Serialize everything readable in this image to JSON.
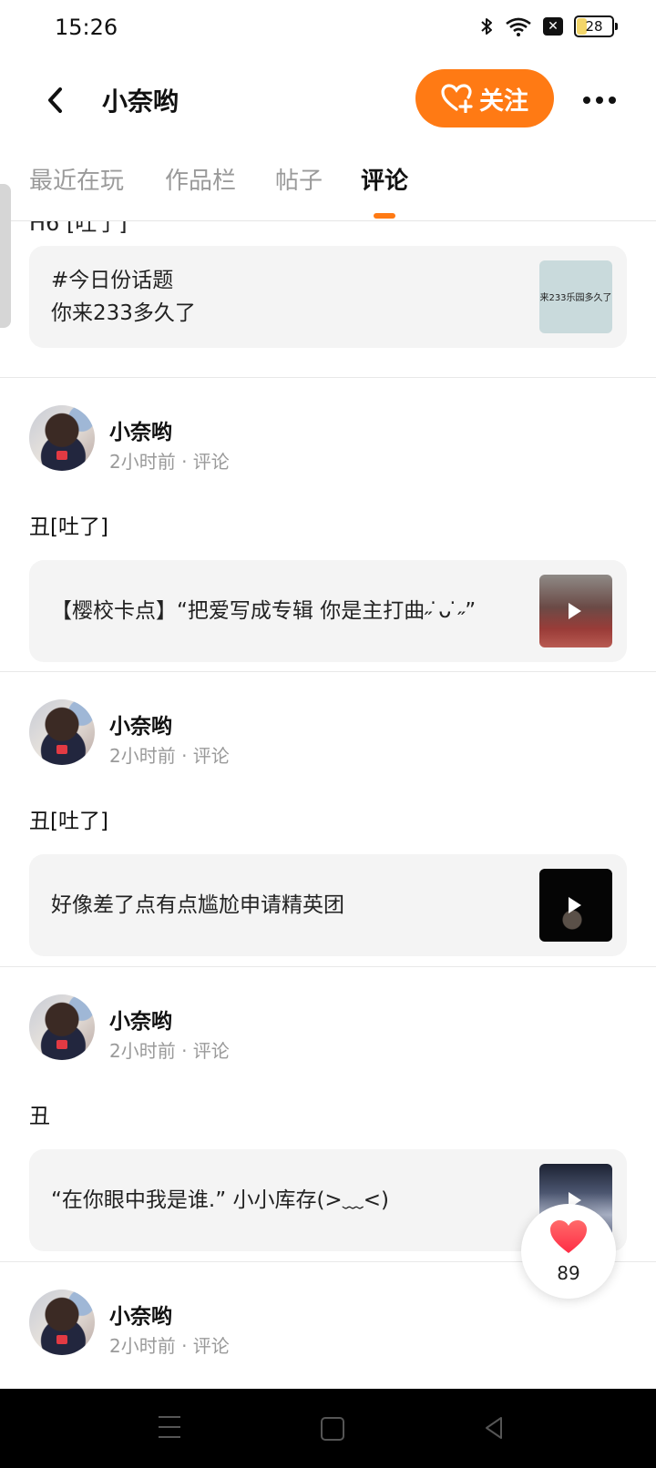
{
  "status_bar": {
    "time": "15:26",
    "battery": "28"
  },
  "header": {
    "title": "小奈哟",
    "follow_label": "关注"
  },
  "tabs": [
    {
      "label": "最近在玩"
    },
    {
      "label": "作品栏"
    },
    {
      "label": "帖子"
    },
    {
      "label": "评论",
      "active": true
    }
  ],
  "feed": {
    "cut_text": "H6 [吐了]",
    "first_card": {
      "line1": "#今日份话题",
      "line2": "你来233多久了",
      "thumb_text": "来233乐园多久了"
    },
    "posts": [
      {
        "author": "小奈哟",
        "meta": "2小时前 · 评论",
        "text": "丑[吐了]",
        "card_text": "【樱校卡点】“把爱写成专辑 你是主打曲˶ ̇ᴗ ̇˶”"
      },
      {
        "author": "小奈哟",
        "meta": "2小时前 · 评论",
        "text": "丑[吐了]",
        "card_text": "好像差了点有点尴尬申请精英团"
      },
      {
        "author": "小奈哟",
        "meta": "2小时前 · 评论",
        "text": "丑",
        "card_text": "“在你眼中我是谁.” 小小库存(>﹏<)"
      },
      {
        "author": "小奈哟",
        "meta": "2小时前 · 评论"
      }
    ]
  },
  "like_button": {
    "count": "89"
  },
  "colors": {
    "accent": "#ff7a14",
    "card_bg": "#f4f4f4",
    "muted": "#9a9a9a"
  }
}
